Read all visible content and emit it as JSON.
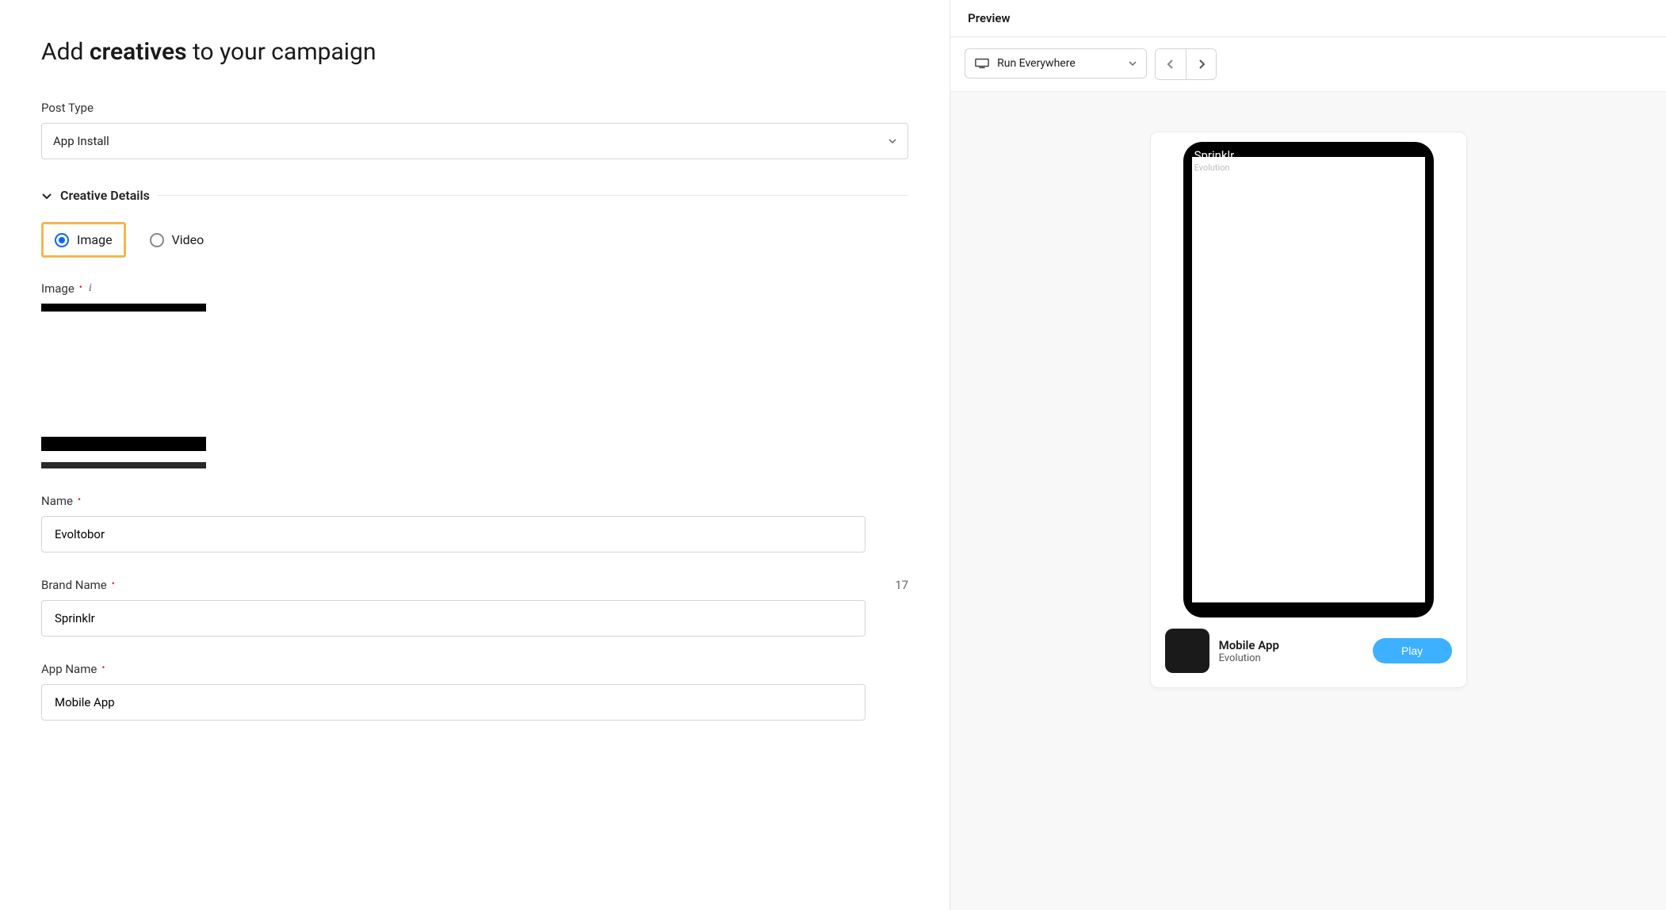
{
  "header": {
    "title_prefix": "Add ",
    "title_strong": "creatives",
    "title_suffix": " to your campaign"
  },
  "form": {
    "post_type": {
      "label": "Post Type",
      "value": "App Install"
    },
    "section_title": "Creative Details",
    "creative_type": {
      "options": {
        "image": "Image",
        "video": "Video"
      },
      "selected": "image"
    },
    "image": {
      "label": "Image"
    },
    "name": {
      "label": "Name",
      "value": "Evoltobor"
    },
    "brand_name": {
      "label": "Brand Name",
      "value": "Sprinklr",
      "remaining": "17"
    },
    "app_name": {
      "label": "App Name",
      "value": "Mobile App"
    }
  },
  "preview": {
    "header_label": "Preview",
    "placement_value": "Run Everywhere",
    "overlay": {
      "brand": "Sprinklr",
      "sub": "Evolution"
    },
    "footer": {
      "app_name": "Mobile App",
      "app_sub": "Evolution",
      "cta_label": "Play"
    }
  }
}
